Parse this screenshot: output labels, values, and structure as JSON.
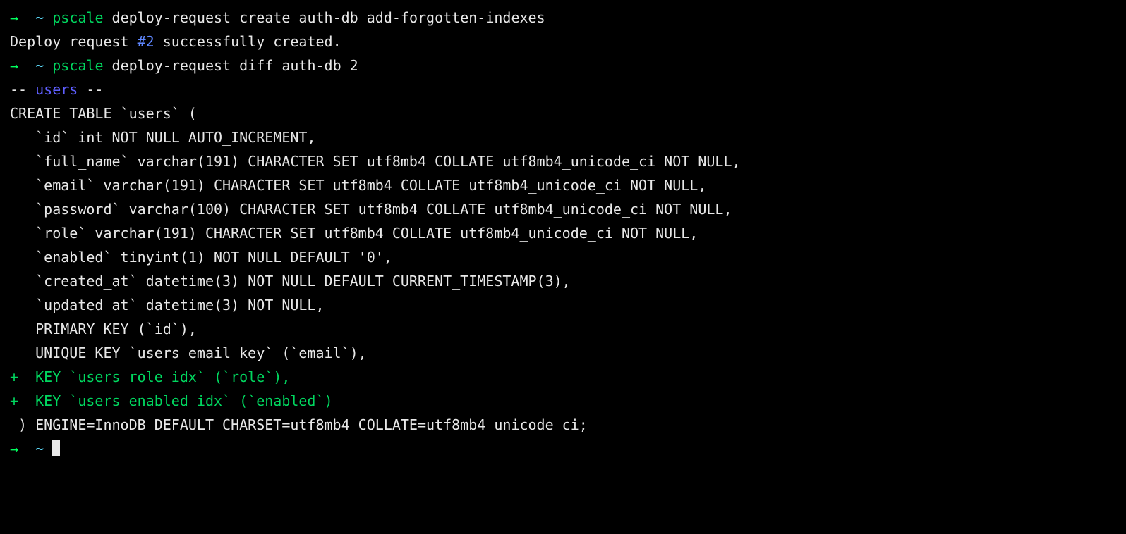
{
  "lines": [
    {
      "type": "prompt",
      "arrow": "→",
      "tilde": "~",
      "cmd": "pscale",
      "rest": " deploy-request create auth-db add-forgotten-indexes"
    },
    {
      "type": "output-deploy",
      "pre": "Deploy request ",
      "num": "#2",
      "post": " successfully created."
    },
    {
      "type": "prompt",
      "arrow": "→",
      "tilde": "~",
      "cmd": "pscale",
      "rest": " deploy-request diff auth-db 2"
    },
    {
      "type": "table-header",
      "pre": "-- ",
      "name": "users",
      "post": " --"
    },
    {
      "type": "plain",
      "text": "CREATE TABLE `users` ("
    },
    {
      "type": "plain",
      "text": "   `id` int NOT NULL AUTO_INCREMENT,"
    },
    {
      "type": "plain",
      "text": "   `full_name` varchar(191) CHARACTER SET utf8mb4 COLLATE utf8mb4_unicode_ci NOT NULL,"
    },
    {
      "type": "plain",
      "text": "   `email` varchar(191) CHARACTER SET utf8mb4 COLLATE utf8mb4_unicode_ci NOT NULL,"
    },
    {
      "type": "plain",
      "text": "   `password` varchar(100) CHARACTER SET utf8mb4 COLLATE utf8mb4_unicode_ci NOT NULL,"
    },
    {
      "type": "plain",
      "text": "   `role` varchar(191) CHARACTER SET utf8mb4 COLLATE utf8mb4_unicode_ci NOT NULL,"
    },
    {
      "type": "plain",
      "text": "   `enabled` tinyint(1) NOT NULL DEFAULT '0',"
    },
    {
      "type": "plain",
      "text": "   `created_at` datetime(3) NOT NULL DEFAULT CURRENT_TIMESTAMP(3),"
    },
    {
      "type": "plain",
      "text": "   `updated_at` datetime(3) NOT NULL,"
    },
    {
      "type": "plain",
      "text": "   PRIMARY KEY (`id`),"
    },
    {
      "type": "plain",
      "text": "   UNIQUE KEY `users_email_key` (`email`),"
    },
    {
      "type": "diff-add",
      "text": "+  KEY `users_role_idx` (`role`),"
    },
    {
      "type": "diff-add",
      "text": "+  KEY `users_enabled_idx` (`enabled`)"
    },
    {
      "type": "plain",
      "text": " ) ENGINE=InnoDB DEFAULT CHARSET=utf8mb4 COLLATE=utf8mb4_unicode_ci;"
    },
    {
      "type": "prompt-cursor",
      "arrow": "→",
      "tilde": "~"
    }
  ]
}
